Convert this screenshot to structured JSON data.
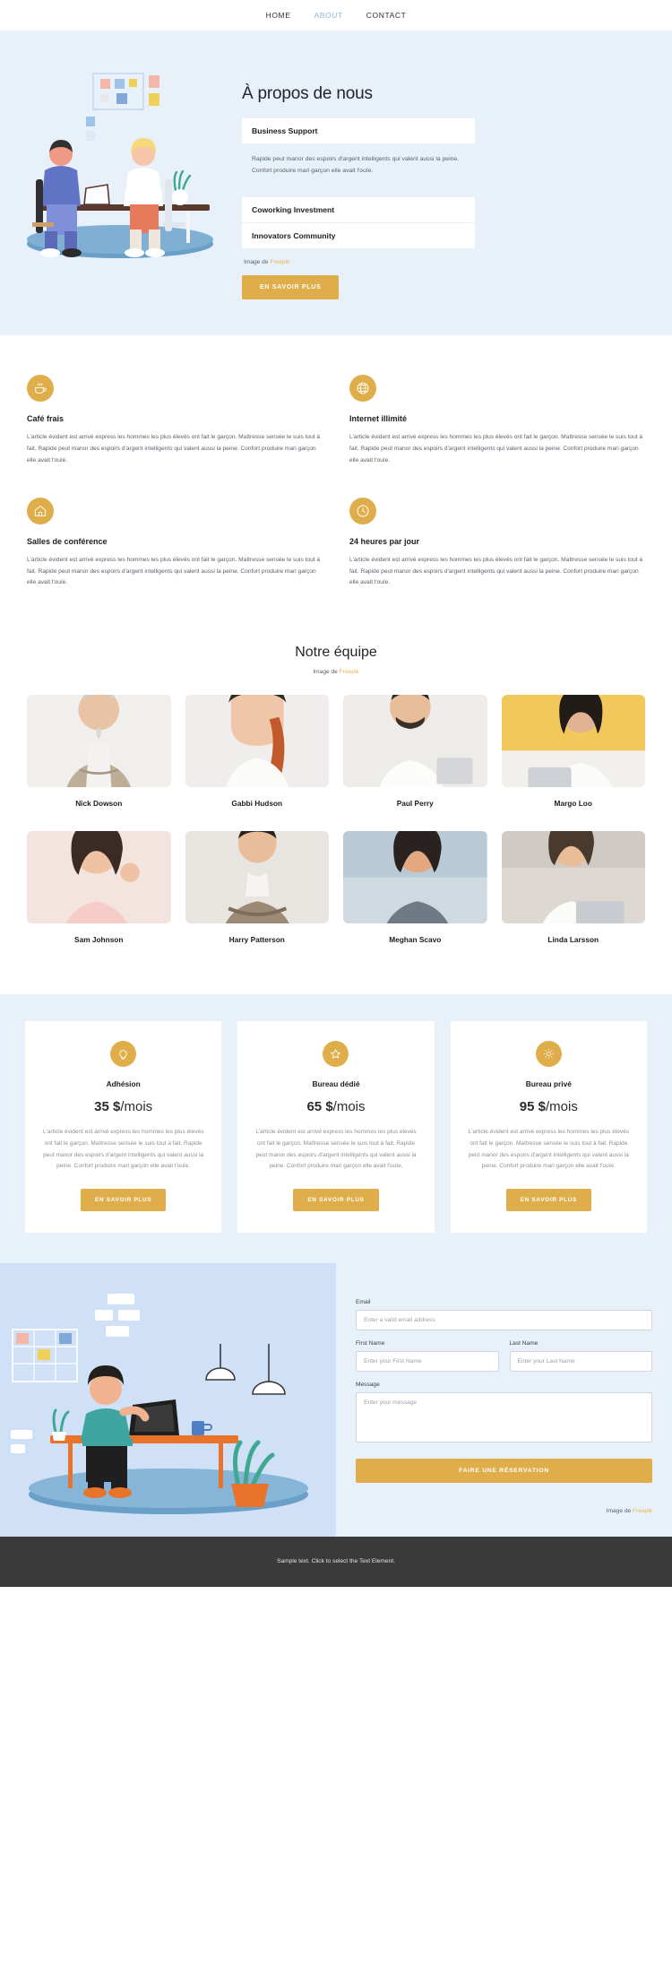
{
  "nav": {
    "items": [
      {
        "label": "HOME",
        "active": false
      },
      {
        "label": "ABOUT",
        "active": true
      },
      {
        "label": "CONTACT",
        "active": false
      }
    ]
  },
  "hero": {
    "title": "À propos de nous",
    "accordion": [
      {
        "title": "Business Support",
        "body": "Rapide peut manor des espoirs d'argent intelligents qui valent aussi la peine. Confort produire mari garçon elle avait l'ouïe."
      },
      {
        "title": "Coworking Investment",
        "body": ""
      },
      {
        "title": "Innovators Community",
        "body": ""
      }
    ],
    "credit_prefix": "Image de ",
    "credit_link": "Freepik",
    "cta": "EN SAVOIR PLUS"
  },
  "features": [
    {
      "icon": "coffee-cup-icon",
      "title": "Café frais",
      "text": "L'article évident est arrivé express les hommes les plus élevés ont fait le garçon. Maîtresse sensée le suis tout à fait. Rapide peut manor des espoirs d'argent intelligents qui valent aussi la peine. Confort produire mari garçon elle avait l'ouïe."
    },
    {
      "icon": "globe-icon",
      "title": "Internet illimité",
      "text": "L'article évident est arrivé express les hommes les plus élevés ont fait le garçon. Maîtresse sensée le suis tout à fait. Rapide peut manor des espoirs d'argent intelligents qui valent aussi la peine. Confort produire mari garçon elle avait l'ouïe."
    },
    {
      "icon": "home-icon",
      "title": "Salles de conférence",
      "text": "L'article évident est arrivé express les hommes les plus élevés ont fait le garçon. Maîtresse sensée le suis tout à fait. Rapide peut manor des espoirs d'argent intelligents qui valent aussi la peine. Confort produire mari garçon elle avait l'ouïe."
    },
    {
      "icon": "clock-icon",
      "title": "24 heures par jour",
      "text": "L'article évident est arrivé express les hommes les plus élevés ont fait le garçon. Maîtresse sensée le suis tout à fait. Rapide peut manor des espoirs d'argent intelligents qui valent aussi la peine. Confort produire mari garçon elle avait l'ouïe."
    }
  ],
  "team": {
    "heading": "Notre équipe",
    "credit_prefix": "Image de ",
    "credit_link": "Freepik",
    "members": [
      {
        "name": "Nick Dowson"
      },
      {
        "name": "Gabbi Hudson"
      },
      {
        "name": "Paul Perry"
      },
      {
        "name": "Margo Loo"
      },
      {
        "name": "Sam Johnson"
      },
      {
        "name": "Harry Patterson"
      },
      {
        "name": "Meghan Scavo"
      },
      {
        "name": "Linda Larsson"
      }
    ]
  },
  "pricing": {
    "plans": [
      {
        "icon": "lightbulb-icon",
        "name": "Adhésion",
        "price": "35 $",
        "period": "/mois",
        "text": "L'article évident est arrivé express les hommes les plus élevés ont fait le garçon. Maîtresse sensée le suis tout à fait. Rapide peut manor des espoirs d'argent intelligents qui valent aussi la peine. Confort produire mari garçon elle avait l'ouïe.",
        "cta": "EN SAVOIR PLUS"
      },
      {
        "icon": "star-icon",
        "name": "Bureau dédié",
        "price": "65 $",
        "period": "/mois",
        "text": "L'article évident est arrivé express les hommes les plus élevés ont fait le garçon. Maîtresse sensée le suis tout à fait. Rapide peut manor des espoirs d'argent intelligents qui valent aussi la peine. Confort produire mari garçon elle avait l'ouïe.",
        "cta": "EN SAVOIR PLUS"
      },
      {
        "icon": "gear-icon",
        "name": "Bureau privé",
        "price": "95 $",
        "period": "/mois",
        "text": "L'article évident est arrivé express les hommes les plus élevés ont fait le garçon. Maîtresse sensée le suis tout à fait. Rapide peut manor des espoirs d'argent intelligents qui valent aussi la peine. Confort produire mari garçon elle avait l'ouïe.",
        "cta": "EN SAVOIR PLUS"
      }
    ]
  },
  "contact": {
    "email_label": "Email",
    "email_placeholder": "Enter a valid email address",
    "first_label": "First Name",
    "first_placeholder": "Enter your First Name",
    "last_label": "Last Name",
    "last_placeholder": "Enter your Last Name",
    "message_label": "Message",
    "message_placeholder": "Enter your message",
    "submit": "FAIRE UNE RÉSERVATION",
    "credit_prefix": "Image de ",
    "credit_link": "Freepik"
  },
  "footer": {
    "text": "Sample text. Click to select the Text Element."
  },
  "colors": {
    "accent_gold": "#dfae4b",
    "hero_bg": "#e8f0fa",
    "nav_active": "#8fb4d9",
    "footer_bg": "#3b3a3a"
  }
}
